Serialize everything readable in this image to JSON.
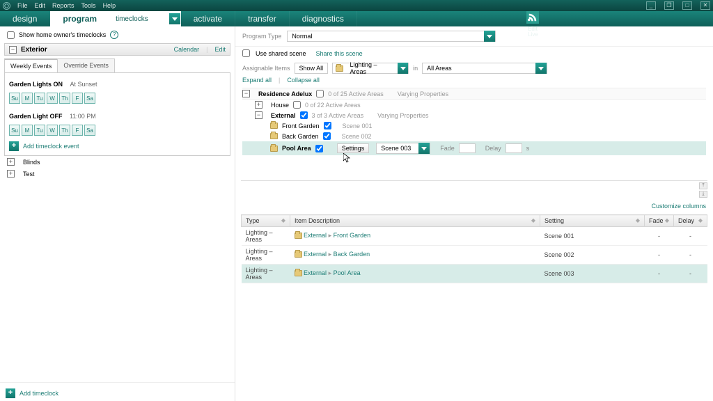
{
  "menubar": {
    "items": [
      "File",
      "Edit",
      "Reports",
      "Tools",
      "Help"
    ]
  },
  "maintabs": {
    "design": "design",
    "program": "program",
    "program_sub": "timeclocks",
    "activate": "activate",
    "transfer": "transfer",
    "diagnostics": "diagnostics",
    "edit": "Edit",
    "live": "Live"
  },
  "left": {
    "show_home_label": "Show home owner's timeclocks",
    "section": "Exterior",
    "calendar": "Calendar",
    "edit": "Edit",
    "subtabs": {
      "weekly": "Weekly Events",
      "override": "Override Events"
    },
    "events": [
      {
        "name": "Garden Lights ON",
        "time": "At Sunset",
        "days": [
          "Su",
          "M",
          "Tu",
          "W",
          "Th",
          "F",
          "Sa"
        ]
      },
      {
        "name": "Garden Light OFF",
        "time": "11:00 PM",
        "days": [
          "Su",
          "M",
          "Tu",
          "W",
          "Th",
          "F",
          "Sa"
        ]
      }
    ],
    "add_event": "Add timeclock event",
    "blinds": "Blinds",
    "test": "Test",
    "add_timeclock": "Add timeclock"
  },
  "right": {
    "program_type_label": "Program Type",
    "program_type_value": "Normal",
    "use_shared_label": "Use shared scene",
    "share_link": "Share this scene",
    "assignable_label": "Assignable Items",
    "show_all": "Show All",
    "lighting_areas": "Lighting – Areas",
    "in": "in",
    "all_areas": "All Areas",
    "expand_all": "Expand all",
    "collapse_all": "Collapse all",
    "residence": "Residence Adelux",
    "residence_meta": "0 of 25 Active Areas",
    "varying": "Varying Properties",
    "house": "House",
    "house_meta": "0 of 22 Active Areas",
    "external": "External",
    "external_meta": "3 of 3 Active Areas",
    "external_varying": "Varying Properties",
    "areas": [
      {
        "name": "Front Garden",
        "scene": "Scene 001"
      },
      {
        "name": "Back Garden",
        "scene": "Scene 002"
      },
      {
        "name": "Pool Area",
        "scene": "Scene 003"
      }
    ],
    "settings_btn": "Settings",
    "scene_dd": "Scene 003",
    "fade": "Fade",
    "delay": "Delay",
    "delay_unit": "s",
    "customize": "Customize columns",
    "table": {
      "headers": {
        "type": "Type",
        "desc": "Item Description",
        "setting": "Setting",
        "fade": "Fade",
        "delay": "Delay"
      },
      "rows": [
        {
          "type": "Lighting – Areas",
          "p1": "External",
          "p2": "Front Garden",
          "setting": "Scene 001",
          "fade": "-",
          "delay": "-"
        },
        {
          "type": "Lighting – Areas",
          "p1": "External",
          "p2": "Back Garden",
          "setting": "Scene 002",
          "fade": "-",
          "delay": "-"
        },
        {
          "type": "Lighting – Areas",
          "p1": "External",
          "p2": "Pool Area",
          "setting": "Scene 003",
          "fade": "-",
          "delay": "-"
        }
      ]
    }
  }
}
